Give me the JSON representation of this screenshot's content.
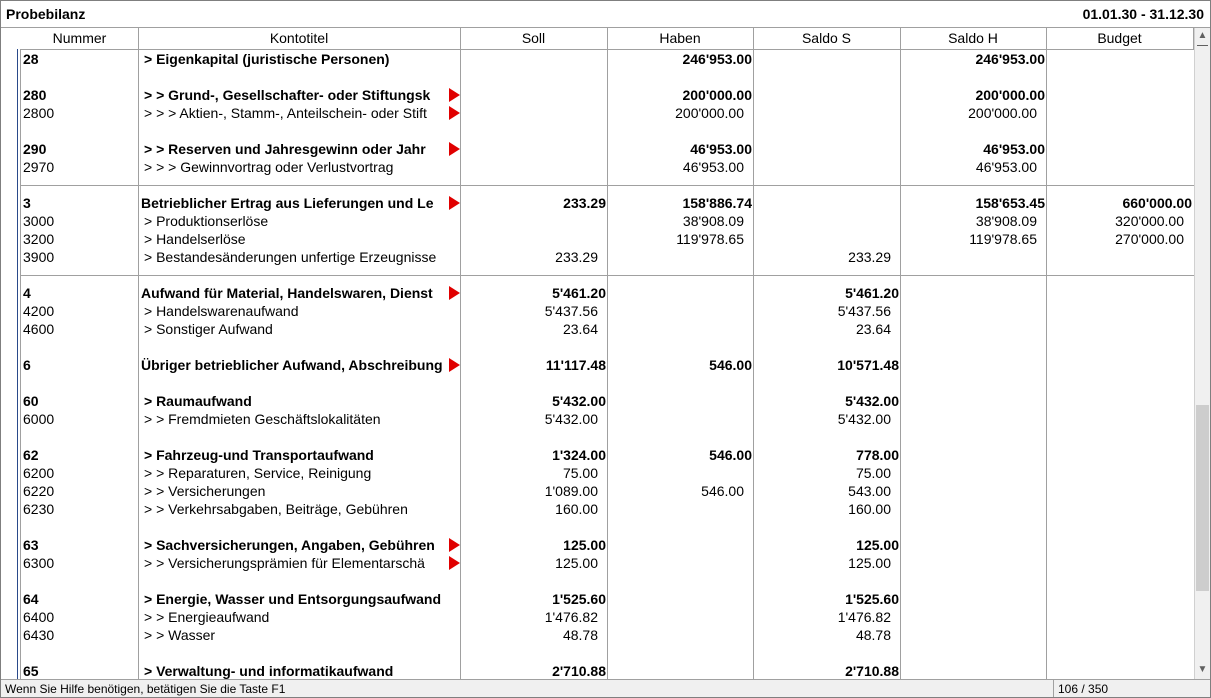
{
  "window": {
    "title": "Probebilanz",
    "period": "01.01.30 - 31.12.30"
  },
  "columns": [
    "Nummer",
    "Kontotitel",
    "Soll",
    "Haben",
    "Saldo S",
    "Saldo H",
    "Budget"
  ],
  "rows": [
    {
      "nr": "28",
      "title": "> Eigenkapital (juristische Personen)",
      "soll": "",
      "haben": "246'953.00",
      "saldo_s": "",
      "saldo_h": "246'953.00",
      "budget": "",
      "bold": true,
      "indent": 0,
      "arrow": false
    },
    {
      "blank": true
    },
    {
      "nr": "280",
      "title": ">  > Grund-, Gesellschafter- oder Stiftungsk",
      "soll": "",
      "haben": "200'000.00",
      "saldo_s": "",
      "saldo_h": "200'000.00",
      "budget": "",
      "bold": true,
      "indent": 1,
      "arrow": true
    },
    {
      "nr": "2800",
      "title": ">  >  > Aktien-, Stamm-, Anteilschein- oder Stift",
      "soll": "",
      "haben": "200'000.00",
      "saldo_s": "",
      "saldo_h": "200'000.00",
      "budget": "",
      "bold": false,
      "indent": 2,
      "arrow": true
    },
    {
      "blank": true
    },
    {
      "nr": "290",
      "title": ">  > Reserven und Jahresgewinn oder Jahr",
      "soll": "",
      "haben": "46'953.00",
      "saldo_s": "",
      "saldo_h": "46'953.00",
      "budget": "",
      "bold": true,
      "indent": 1,
      "arrow": true
    },
    {
      "nr": "2970",
      "title": ">  >  > Gewinnvortrag oder Verlustvortrag",
      "soll": "",
      "haben": "46'953.00",
      "saldo_s": "",
      "saldo_h": "46'953.00",
      "budget": "",
      "bold": false,
      "indent": 2,
      "arrow": false
    },
    {
      "blank": true,
      "sep": true
    },
    {
      "nr": "3",
      "title": "Betrieblicher Ertrag aus Lieferungen und Le",
      "soll": "233.29",
      "haben": "158'886.74",
      "saldo_s": "",
      "saldo_h": "158'653.45",
      "budget": "660'000.00",
      "bold": true,
      "indent": 0,
      "arrow": true
    },
    {
      "nr": "3000",
      "title": "> Produktionserlöse",
      "soll": "",
      "haben": "38'908.09",
      "saldo_s": "",
      "saldo_h": "38'908.09",
      "budget": "320'000.00",
      "bold": false,
      "indent": 1,
      "arrow": false
    },
    {
      "nr": "3200",
      "title": "> Handelserlöse",
      "soll": "",
      "haben": "119'978.65",
      "saldo_s": "",
      "saldo_h": "119'978.65",
      "budget": "270'000.00",
      "bold": false,
      "indent": 1,
      "arrow": false
    },
    {
      "nr": "3900",
      "title": "> Bestandesänderungen unfertige Erzeugnisse",
      "soll": "233.29",
      "haben": "",
      "saldo_s": "233.29",
      "saldo_h": "",
      "budget": "",
      "bold": false,
      "indent": 1,
      "arrow": false
    },
    {
      "blank": true,
      "sep": true
    },
    {
      "nr": "4",
      "title": "Aufwand für Material, Handelswaren, Dienst",
      "soll": "5'461.20",
      "haben": "",
      "saldo_s": "5'461.20",
      "saldo_h": "",
      "budget": "",
      "bold": true,
      "indent": 0,
      "arrow": true
    },
    {
      "nr": "4200",
      "title": "> Handelswarenaufwand",
      "soll": "5'437.56",
      "haben": "",
      "saldo_s": "5'437.56",
      "saldo_h": "",
      "budget": "",
      "bold": false,
      "indent": 1,
      "arrow": false
    },
    {
      "nr": "4600",
      "title": "> Sonstiger Aufwand",
      "soll": "23.64",
      "haben": "",
      "saldo_s": "23.64",
      "saldo_h": "",
      "budget": "",
      "bold": false,
      "indent": 1,
      "arrow": false
    },
    {
      "blank": true
    },
    {
      "nr": "6",
      "title": "Übriger betrieblicher Aufwand, Abschreibung",
      "soll": "11'117.48",
      "haben": "546.00",
      "saldo_s": "10'571.48",
      "saldo_h": "",
      "budget": "",
      "bold": true,
      "indent": 0,
      "arrow": true
    },
    {
      "blank": true
    },
    {
      "nr": "60",
      "title": "> Raumaufwand",
      "soll": "5'432.00",
      "haben": "",
      "saldo_s": "5'432.00",
      "saldo_h": "",
      "budget": "",
      "bold": true,
      "indent": 1,
      "arrow": false
    },
    {
      "nr": "6000",
      "title": ">  > Fremdmieten Geschäftslokalitäten",
      "soll": "5'432.00",
      "haben": "",
      "saldo_s": "5'432.00",
      "saldo_h": "",
      "budget": "",
      "bold": false,
      "indent": 2,
      "arrow": false
    },
    {
      "blank": true
    },
    {
      "nr": "62",
      "title": "> Fahrzeug-und Transportaufwand",
      "soll": "1'324.00",
      "haben": "546.00",
      "saldo_s": "778.00",
      "saldo_h": "",
      "budget": "",
      "bold": true,
      "indent": 1,
      "arrow": false
    },
    {
      "nr": "6200",
      "title": ">  > Reparaturen, Service, Reinigung",
      "soll": "75.00",
      "haben": "",
      "saldo_s": "75.00",
      "saldo_h": "",
      "budget": "",
      "bold": false,
      "indent": 2,
      "arrow": false
    },
    {
      "nr": "6220",
      "title": ">  > Versicherungen",
      "soll": "1'089.00",
      "haben": "546.00",
      "saldo_s": "543.00",
      "saldo_h": "",
      "budget": "",
      "bold": false,
      "indent": 2,
      "arrow": false
    },
    {
      "nr": "6230",
      "title": ">  > Verkehrsabgaben, Beiträge, Gebühren",
      "soll": "160.00",
      "haben": "",
      "saldo_s": "160.00",
      "saldo_h": "",
      "budget": "",
      "bold": false,
      "indent": 2,
      "arrow": false
    },
    {
      "blank": true
    },
    {
      "nr": "63",
      "title": "> Sachversicherungen, Angaben, Gebühren",
      "soll": "125.00",
      "haben": "",
      "saldo_s": "125.00",
      "saldo_h": "",
      "budget": "",
      "bold": true,
      "indent": 1,
      "arrow": true
    },
    {
      "nr": "6300",
      "title": ">  > Versicherungsprämien für Elementarschä",
      "soll": "125.00",
      "haben": "",
      "saldo_s": "125.00",
      "saldo_h": "",
      "budget": "",
      "bold": false,
      "indent": 2,
      "arrow": true
    },
    {
      "blank": true
    },
    {
      "nr": "64",
      "title": "> Energie, Wasser und Entsorgungsaufwand",
      "soll": "1'525.60",
      "haben": "",
      "saldo_s": "1'525.60",
      "saldo_h": "",
      "budget": "",
      "bold": true,
      "indent": 1,
      "arrow": false
    },
    {
      "nr": "6400",
      "title": ">  > Energieaufwand",
      "soll": "1'476.82",
      "haben": "",
      "saldo_s": "1'476.82",
      "saldo_h": "",
      "budget": "",
      "bold": false,
      "indent": 2,
      "arrow": false
    },
    {
      "nr": "6430",
      "title": ">  > Wasser",
      "soll": "48.78",
      "haben": "",
      "saldo_s": "48.78",
      "saldo_h": "",
      "budget": "",
      "bold": false,
      "indent": 2,
      "arrow": false
    },
    {
      "blank": true
    },
    {
      "nr": "65",
      "title": "> Verwaltung- und informatikaufwand",
      "soll": "2'710.88",
      "haben": "",
      "saldo_s": "2'710.88",
      "saldo_h": "",
      "budget": "",
      "bold": true,
      "indent": 1,
      "arrow": false
    }
  ],
  "status": {
    "hint": "Wenn Sie Hilfe benötigen, betätigen Sie die Taste F1",
    "position": "106 / 350"
  },
  "icons": {
    "scroll_up": "chevron-up-icon",
    "scroll_down": "chevron-down-icon",
    "truncation": "red-arrow-icon"
  },
  "colors": {
    "truncation_arrow": "#e00000",
    "grid": "#a0a0a0"
  }
}
